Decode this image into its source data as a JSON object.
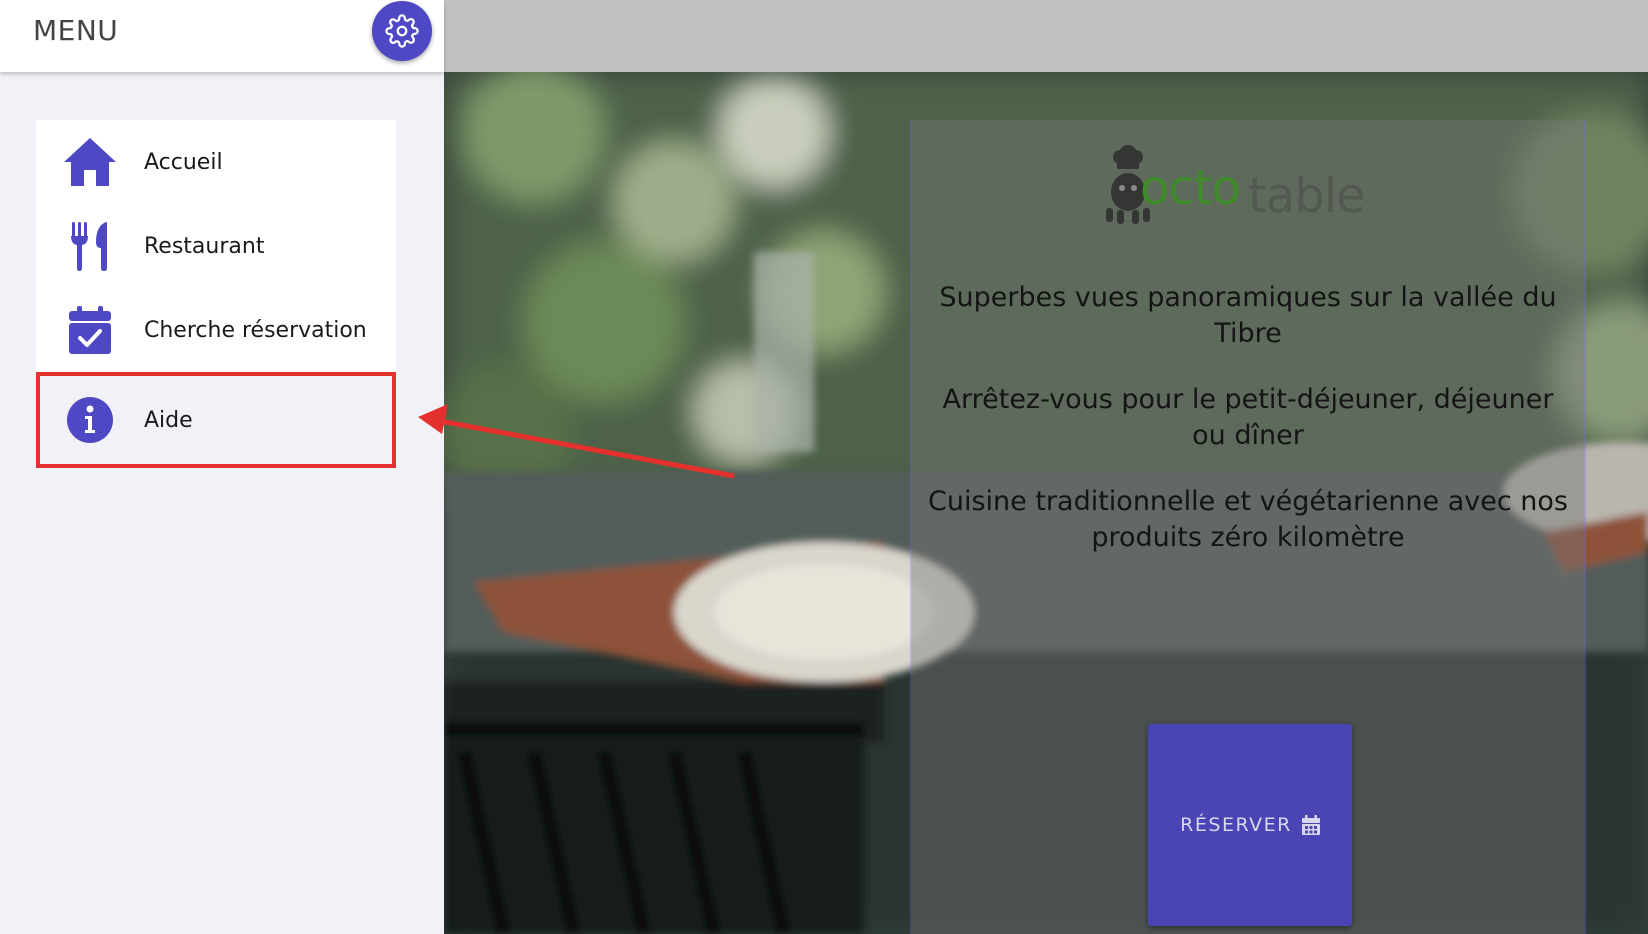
{
  "sidebar": {
    "title": "MENU",
    "settings_icon": "gear-icon",
    "items": [
      {
        "label": "Accueil",
        "icon": "home-icon"
      },
      {
        "label": "Restaurant",
        "icon": "utensils-icon"
      },
      {
        "label": "Cherche réservation",
        "icon": "calendar-check-icon"
      },
      {
        "label": "Aide",
        "icon": "info-icon",
        "highlighted": true
      }
    ]
  },
  "hero": {
    "logo": {
      "part1": "octo",
      "part2": "table"
    },
    "lines": [
      "Superbes vues panoramiques sur la vallée du Tibre",
      "Arrêtez-vous pour le petit-déjeuner, déjeuner ou dîner",
      "Cuisine traditionnelle et végétarienne avec nos produits zéro kilomètre"
    ],
    "reserve_button": {
      "label": "RÉSERVER",
      "icon": "calendar-icon"
    }
  },
  "colors": {
    "accent": "#4f48c4",
    "highlight": "#e5312d",
    "topbar": "#c2c2c2"
  }
}
